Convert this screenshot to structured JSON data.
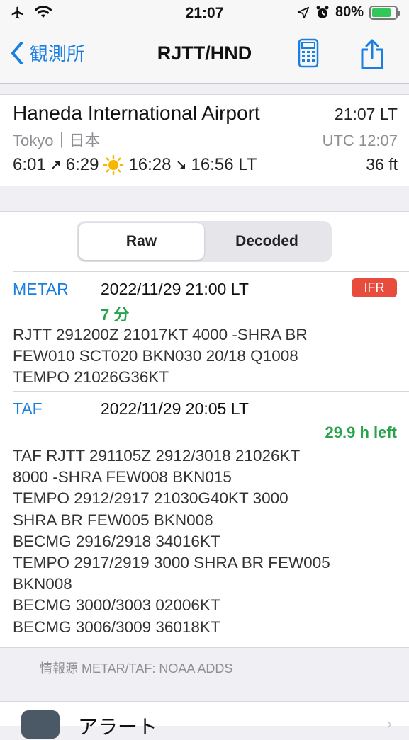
{
  "status_bar": {
    "time": "21:07",
    "battery": "80%",
    "battery_level": 0.8,
    "airplane_icon": "airplane-icon",
    "wifi_icon": "wifi-icon"
  },
  "nav": {
    "back_label": "観測所",
    "title": "RJTT/HND"
  },
  "airport": {
    "name": "Haneda International Airport",
    "local_time": "21:07 LT",
    "location": "Tokyo｜日本",
    "utc_time": "UTC 12:07",
    "dawn": "6:01",
    "sunrise": "6:29",
    "sunset": "16:28",
    "dusk": "16:56 LT",
    "elevation": "36 ft"
  },
  "segmented": {
    "raw_label": "Raw",
    "decoded_label": "Decoded",
    "selected": "Raw"
  },
  "metar": {
    "label": "METAR",
    "issued": "2022/11/29 21:00 LT",
    "age": "7 分",
    "category": "IFR",
    "category_color": "#e74c3c",
    "raw_lines": [
      "RJTT 291200Z 21017KT 4000 -SHRA BR",
      "FEW010 SCT020 BKN030 20/18 Q1008",
      "TEMPO 21026G36KT"
    ]
  },
  "taf": {
    "label": "TAF",
    "issued": "2022/11/29 20:05 LT",
    "validity": "29.9 h left",
    "raw_lines": [
      "TAF RJTT 291105Z 2912/3018 21026KT",
      "8000 -SHRA FEW008 BKN015",
      "TEMPO 2912/2917 21030G40KT 3000",
      "SHRA BR FEW005 BKN008",
      "BECMG 2916/2918 34016KT",
      "TEMPO 2917/2919 3000 SHRA BR FEW005",
      "BKN008",
      "BECMG 3000/3003 02006KT",
      "BECMG 3006/3009 36018KT"
    ]
  },
  "source": "情報源 METAR/TAF: NOAA ADDS",
  "bottom_item": {
    "label": "アラート"
  }
}
